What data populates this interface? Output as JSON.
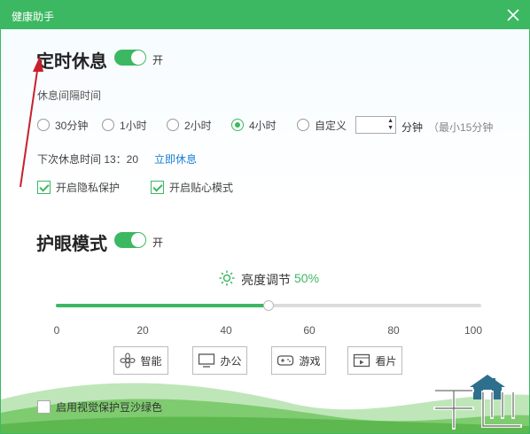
{
  "window": {
    "title": "健康助手"
  },
  "rest": {
    "title": "定时休息",
    "toggle_text": "开",
    "interval_label": "休息间隔时间",
    "options": [
      {
        "label": "30分钟",
        "checked": false
      },
      {
        "label": "1小时",
        "checked": false
      },
      {
        "label": "2小时",
        "checked": false
      },
      {
        "label": "4小时",
        "checked": true
      },
      {
        "label": "自定义",
        "checked": false
      }
    ],
    "custom_value": "",
    "custom_unit": "分钟",
    "custom_hint": "（最小15分钟",
    "next_rest_text": "下次休息时间 13：20",
    "rest_now": "立即休息",
    "privacy_label": "开启隐私保护",
    "privacy_checked": true,
    "care_label": "开启贴心模式",
    "care_checked": true
  },
  "eye": {
    "title": "护眼模式",
    "toggle_text": "开",
    "brightness_label": "亮度调节",
    "brightness_value": "50%",
    "brightness_level": 0.5,
    "ticks": [
      "0",
      "20",
      "40",
      "60",
      "80",
      "100"
    ],
    "modes": [
      {
        "label": "智能",
        "icon": "flower-icon"
      },
      {
        "label": "办公",
        "icon": "monitor-icon"
      },
      {
        "label": "游戏",
        "icon": "gamepad-icon"
      },
      {
        "label": "看片",
        "icon": "film-icon"
      }
    ],
    "bean_green_label": "启用视觉保护豆沙绿色",
    "bean_green_checked": false
  },
  "colors": {
    "accent": "#3cb862",
    "link": "#1a7fd4",
    "annotation": "#c9202a"
  }
}
